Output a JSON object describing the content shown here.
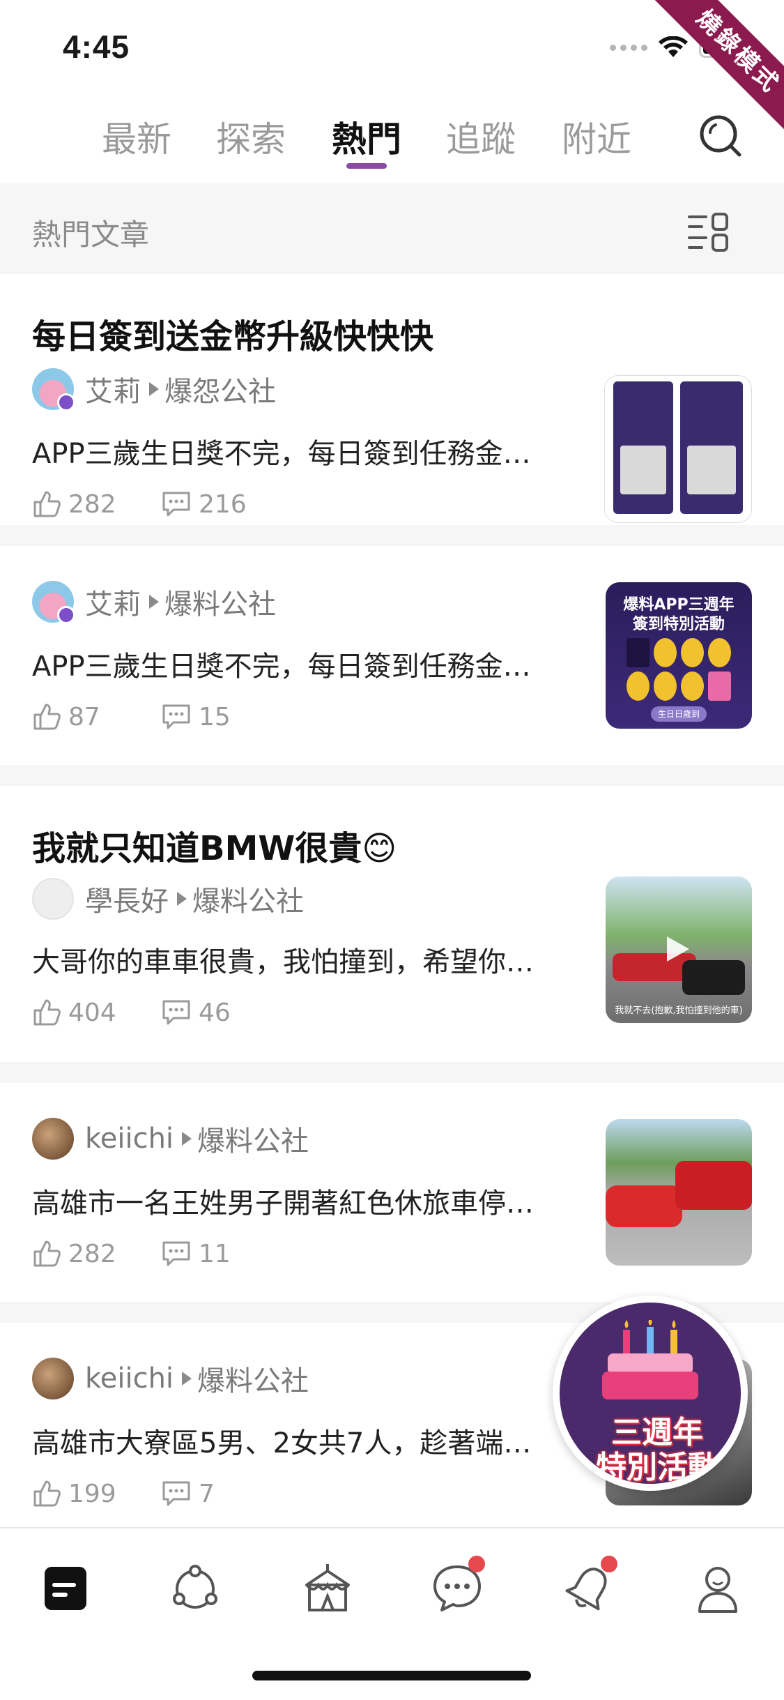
{
  "status_bar": {
    "time": "4:45"
  },
  "ribbon": {
    "text": "燒錄模式"
  },
  "tabs": [
    {
      "label": "最新"
    },
    {
      "label": "探索"
    },
    {
      "label": "熱門"
    },
    {
      "label": "追蹤"
    },
    {
      "label": "附近"
    }
  ],
  "active_tab": "熱門",
  "section": {
    "title": "熱門文章"
  },
  "posts": [
    {
      "title": "每日簽到送金幣升級快快快",
      "author": "艾莉",
      "board": "爆怨公社",
      "excerpt": "APP三歲生日獎不完，每日簽到任務金…",
      "likes": "282",
      "comments": "216"
    },
    {
      "title": "",
      "author": "艾莉",
      "board": "爆料公社",
      "excerpt": "APP三歲生日獎不完，每日簽到任務金…",
      "likes": "87",
      "comments": "15",
      "thumb_title": "爆料APP三週年",
      "thumb_subtitle": "簽到特別活動",
      "thumb_button": "生日日歲到"
    },
    {
      "title": "我就只知道BMW很貴😊",
      "author": "學長好",
      "board": "爆料公社",
      "excerpt": "大哥你的車車很貴，我怕撞到，希望你…",
      "likes": "404",
      "comments": "46",
      "thumb_caption": "我就不去(抱歉,我怕撞到他的車)"
    },
    {
      "title": "",
      "author": "keiichi",
      "board": "爆料公社",
      "excerpt": "高雄市一名王姓男子開著紅色休旅車停…",
      "likes": "282",
      "comments": "11"
    },
    {
      "title": "",
      "author": "keiichi",
      "board": "爆料公社",
      "excerpt": "高雄市大寮區5男、2女共7人，趁著端…",
      "likes": "199",
      "comments": "7"
    }
  ],
  "promo": {
    "line1": "三週年",
    "line2": "特別活動"
  },
  "colors": {
    "accent": "#8b4aa5",
    "badge": "#e5484d",
    "ribbon": "#8b1a4f"
  }
}
